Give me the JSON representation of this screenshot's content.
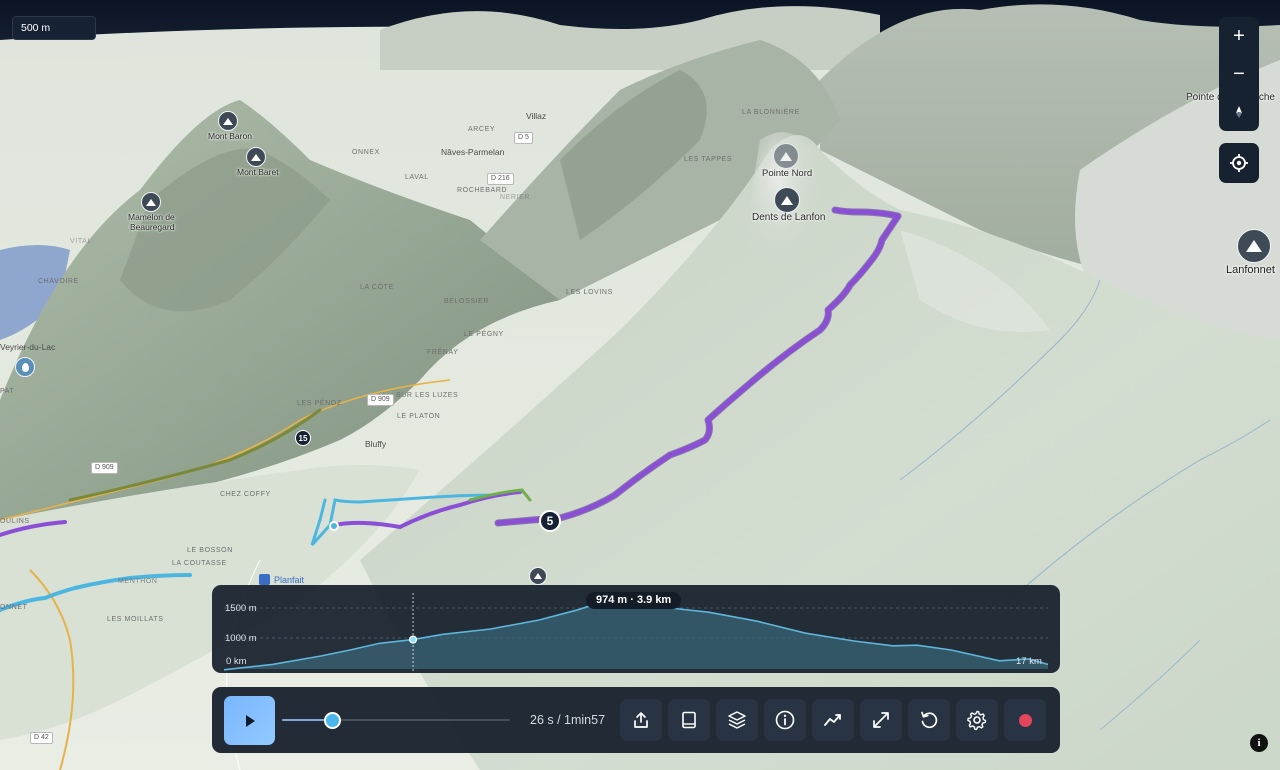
{
  "scale": {
    "label": "500 m"
  },
  "map": {
    "peaks": {
      "mont_baron": "Mont Baron",
      "mont_baret": "Mont Baret",
      "mamelon_line1": "Mamelon de",
      "mamelon_line2": "Beauregard",
      "pointe_nord": "Pointe Nord",
      "dents_de_lanfon": "Dents de Lanfon",
      "lanfonnet": "Lanfonnet",
      "pointe_marche": "Pointe de la Marche"
    },
    "places": {
      "villaz": "Villaz",
      "arcey": "ARCEY",
      "onnex": "ONNEX",
      "naves": "Nâves-Parmelan",
      "laval": "LAVAL",
      "rochebard": "ROCHEBARD",
      "nerier": "NERIER",
      "la_blonniere": "LA BLONNIÈRE",
      "les_tappes": "LES TAPPES",
      "vital": "VITAL",
      "chavoire": "CHAVOIRE",
      "la_cote": "LA CÔTE",
      "belossier": "BELOSSIER",
      "les_lovins": "LES LOVINS",
      "le_pegny": "LE PÉGNY",
      "frenay": "FRÉNAY",
      "veyrier": "Veyrier-du-Lac",
      "pat": "PAT",
      "les_penoz": "LES PÉNOZ",
      "sur_les_luzes": "SUR LES LUZES",
      "le_platon": "LE PLATON",
      "bluffy": "Bluffy",
      "chez_coffy": "CHEZ COFFY",
      "oulins": "OULINS",
      "le_bosson": "LE BOSSON",
      "la_coutasse": "LA COUTASSE",
      "menthon": "MENTHON",
      "les_moillats": "LES MOILLATS",
      "onnet": "ONNET",
      "planfait": "Planfait"
    },
    "roads": {
      "d5": "D 5",
      "d216": "D 216",
      "d909a": "D 909",
      "d909b": "D 909",
      "d42": "D 42"
    },
    "waypoints": {
      "main": "5",
      "secondary": "15"
    }
  },
  "zoom": {
    "in": "+",
    "out": "−"
  },
  "elevation": {
    "y_high": "1500 m",
    "y_mid": "1000 m",
    "x_start": "0 km",
    "x_end": "17 km",
    "tooltip": "974 m · 3.9 km",
    "total_km": 17,
    "cursor_km": 3.9,
    "profile": [
      [
        0,
        470
      ],
      [
        1,
        560
      ],
      [
        2,
        700
      ],
      [
        2.6,
        800
      ],
      [
        3.2,
        910
      ],
      [
        3.9,
        974
      ],
      [
        4.5,
        1060
      ],
      [
        5.5,
        1150
      ],
      [
        6.5,
        1300
      ],
      [
        7.3,
        1470
      ],
      [
        7.9,
        1625
      ],
      [
        8.4,
        1560
      ],
      [
        9.2,
        1500
      ],
      [
        10,
        1430
      ],
      [
        11,
        1280
      ],
      [
        12,
        1080
      ],
      [
        13,
        950
      ],
      [
        13.8,
        870
      ],
      [
        14.3,
        880
      ],
      [
        15,
        800
      ],
      [
        16,
        620
      ],
      [
        16.6,
        650
      ],
      [
        17,
        560
      ]
    ],
    "chart_range": [
      300,
      1800
    ]
  },
  "player": {
    "time": "26 s / 1min57",
    "progress": 0.22
  },
  "colors": {
    "route_purple": "#8b4fd6",
    "route_blue": "#4cb6e0",
    "elev_line": "#5fb6db",
    "record": "#e5455b",
    "play": "#84bdff"
  }
}
